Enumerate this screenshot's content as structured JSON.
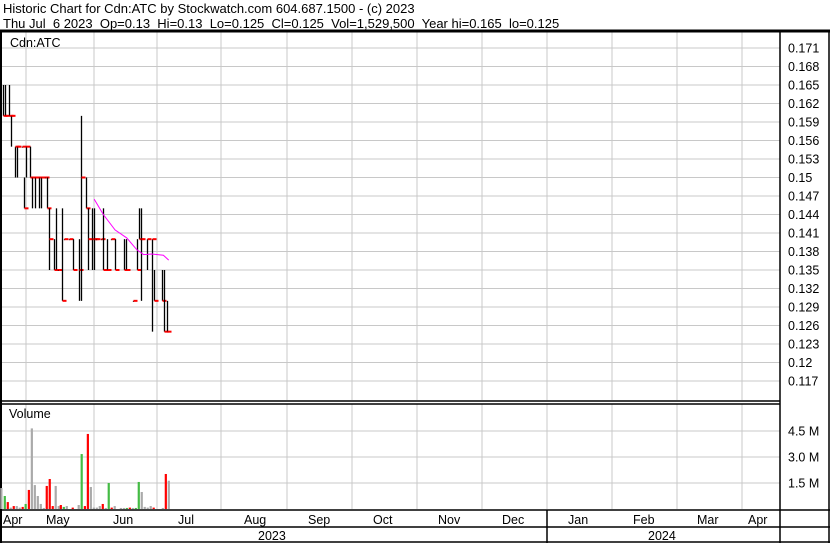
{
  "header": {
    "title": "Historic Chart for Cdn:ATC by Stockwatch.com 604.687.1500 - (c) 2023",
    "quote": "Thu Jul  6 2023  Op=0.13  Hi=0.13  Lo=0.125  Cl=0.125  Vol=1,529,500  Year hi=0.165  lo=0.125"
  },
  "colors": {
    "up": "#000000",
    "close_tick": "#ff0000",
    "ma": "#ff00ff",
    "vol_up": "#44bb44",
    "vol_down": "#ff0000",
    "vol_flat": "#aaaaaa",
    "grid": "#c8c8c8"
  },
  "chart_data": [
    {
      "type": "ohlc",
      "title": "Cdn:ATC",
      "x_unit": "days from May 1 2023",
      "ylim": [
        0.115,
        0.172
      ],
      "yticks": [
        "0.171",
        "0.168",
        "0.165",
        "0.162",
        "0.159",
        "0.156",
        "0.153",
        "0.15",
        "0.147",
        "0.144",
        "0.141",
        "0.138",
        "0.135",
        "0.132",
        "0.129",
        "0.126",
        "0.123",
        "0.12",
        "0.117"
      ],
      "bars": [
        [
          -11,
          0.165,
          0.16,
          0.16
        ],
        [
          -10,
          0.165,
          0.16,
          0.16
        ],
        [
          -8,
          0.165,
          0.16,
          0.16
        ],
        [
          -7,
          0.16,
          0.155,
          0.16
        ],
        [
          -5,
          0.155,
          0.15,
          0.155
        ],
        [
          -4,
          0.155,
          0.15,
          0.155
        ],
        [
          -2,
          0.155,
          0.155,
          0.155
        ],
        [
          -1,
          0.15,
          0.145,
          0.145
        ],
        [
          0,
          0.155,
          0.15,
          0.155
        ],
        [
          2,
          0.155,
          0.15,
          0.15
        ],
        [
          3,
          0.15,
          0.145,
          0.15
        ],
        [
          4,
          0.15,
          0.145,
          0.15
        ],
        [
          6,
          0.15,
          0.145,
          0.15
        ],
        [
          7,
          0.15,
          0.145,
          0.15
        ],
        [
          9,
          0.15,
          0.15,
          0.15
        ],
        [
          10,
          0.15,
          0.145,
          0.145
        ],
        [
          11,
          0.145,
          0.135,
          0.14
        ],
        [
          13,
          0.14,
          0.135,
          0.135
        ],
        [
          14,
          0.145,
          0.135,
          0.135
        ],
        [
          15,
          0.135,
          0.135,
          0.135
        ],
        [
          17,
          0.145,
          0.13,
          0.13
        ],
        [
          18,
          0.14,
          0.14,
          0.14
        ],
        [
          20,
          0.14,
          0.14,
          0.14
        ],
        [
          22,
          0.14,
          0.135,
          0.135
        ],
        [
          25,
          0.14,
          0.13,
          0.135
        ],
        [
          26,
          0.16,
          0.13,
          0.15
        ],
        [
          28,
          0.15,
          0.145,
          0.145
        ],
        [
          29,
          0.145,
          0.135,
          0.14
        ],
        [
          31,
          0.145,
          0.135,
          0.14
        ],
        [
          32,
          0.145,
          0.135,
          0.14
        ],
        [
          33,
          0.14,
          0.14,
          0.14
        ],
        [
          35,
          0.14,
          0.14,
          0.14
        ],
        [
          36,
          0.145,
          0.135,
          0.135
        ],
        [
          38,
          0.14,
          0.135,
          0.135
        ],
        [
          40,
          0.14,
          0.14,
          0.14
        ],
        [
          42,
          0.14,
          0.135,
          0.135
        ],
        [
          46,
          0.14,
          0.135,
          0.135
        ],
        [
          47,
          0.14,
          0.135,
          0.135
        ],
        [
          50,
          0.13,
          0.13,
          0.13
        ],
        [
          52,
          0.14,
          0.135,
          0.135
        ],
        [
          53,
          0.145,
          0.14,
          0.14
        ],
        [
          54,
          0.145,
          0.13,
          0.14
        ],
        [
          57,
          0.14,
          0.135,
          0.14
        ],
        [
          59,
          0.14,
          0.125,
          0.14
        ],
        [
          60,
          0.135,
          0.13,
          0.13
        ],
        [
          64,
          0.135,
          0.13,
          0.13
        ],
        [
          65,
          0.135,
          0.125,
          0.125
        ],
        [
          66,
          0.13,
          0.125,
          0.125
        ]
      ],
      "moving_average": [
        [
          32,
          0.1465
        ],
        [
          36.3,
          0.144
        ],
        [
          41.8,
          0.1415
        ],
        [
          47.3,
          0.1402
        ],
        [
          52,
          0.1383
        ],
        [
          55.2,
          0.1375
        ],
        [
          59,
          0.1376
        ],
        [
          64.5,
          0.1374
        ],
        [
          67,
          0.1366
        ]
      ]
    },
    {
      "type": "bar",
      "title": "Volume",
      "ylim_millions": [
        0,
        5.5
      ],
      "yticks": [
        "4.5 M",
        "3.0 M",
        "1.5 M"
      ],
      "bars": [
        [
          -11.6,
          1.21,
          "f"
        ],
        [
          -10,
          0.75,
          "u"
        ],
        [
          -8.6,
          0.4,
          "d"
        ],
        [
          -7.2,
          0.08,
          "f"
        ],
        [
          -5.8,
          0.17,
          "d"
        ],
        [
          -4.4,
          0.17,
          "f"
        ],
        [
          -3,
          0.08,
          "f"
        ],
        [
          -1.6,
          0.12,
          "d"
        ],
        [
          -0.2,
          0.29,
          "u"
        ],
        [
          1.3,
          1.1,
          "d"
        ],
        [
          2.7,
          4.65,
          "f"
        ],
        [
          4.1,
          1.38,
          "f"
        ],
        [
          5.5,
          0.75,
          "f"
        ],
        [
          6.9,
          0.29,
          "f"
        ],
        [
          8.3,
          0.06,
          "f"
        ],
        [
          9.7,
          1.33,
          "d"
        ],
        [
          11.1,
          1.73,
          "d"
        ],
        [
          12.5,
          0.17,
          "d"
        ],
        [
          13.9,
          1.33,
          "f"
        ],
        [
          15.3,
          0.17,
          "f"
        ],
        [
          16.3,
          0.23,
          "d"
        ],
        [
          17.7,
          0.12,
          "u"
        ],
        [
          19.1,
          0.17,
          "f"
        ],
        [
          21.9,
          0.08,
          "d"
        ],
        [
          24.7,
          0.23,
          "f"
        ],
        [
          26.1,
          3.17,
          "u"
        ],
        [
          27.6,
          0.17,
          "d"
        ],
        [
          29,
          4.33,
          "d"
        ],
        [
          30.4,
          1.27,
          "f"
        ],
        [
          31.8,
          0.08,
          "f"
        ],
        [
          33.2,
          0.08,
          "f"
        ],
        [
          34.6,
          0.17,
          "f"
        ],
        [
          36,
          0.29,
          "d"
        ],
        [
          37.4,
          0.06,
          "f"
        ],
        [
          38.8,
          1.5,
          "u"
        ],
        [
          40.2,
          0.08,
          "d"
        ],
        [
          41.6,
          0.17,
          "f"
        ],
        [
          44.5,
          0.06,
          "f"
        ],
        [
          45.9,
          0.06,
          "f"
        ],
        [
          47.3,
          0.06,
          "u"
        ],
        [
          48.7,
          0.08,
          "d"
        ],
        [
          50.1,
          0.06,
          "f"
        ],
        [
          51.5,
          0.06,
          "u"
        ],
        [
          52.9,
          1.56,
          "u"
        ],
        [
          54.3,
          0.98,
          "f"
        ],
        [
          55.7,
          0.12,
          "f"
        ],
        [
          57.1,
          0.08,
          "f"
        ],
        [
          58.5,
          0.17,
          "f"
        ],
        [
          59.9,
          0.08,
          "d"
        ],
        [
          64.2,
          0.06,
          "f"
        ],
        [
          65.6,
          2.02,
          "d"
        ],
        [
          67,
          1.63,
          "f"
        ]
      ]
    }
  ],
  "x_axis": {
    "months": [
      "Apr",
      "May",
      "Jun",
      "Jul",
      "Aug",
      "Sep",
      "Oct",
      "Nov",
      "Dec",
      "Jan",
      "Feb",
      "Mar",
      "Apr"
    ],
    "years": [
      "2023",
      "2024"
    ]
  }
}
